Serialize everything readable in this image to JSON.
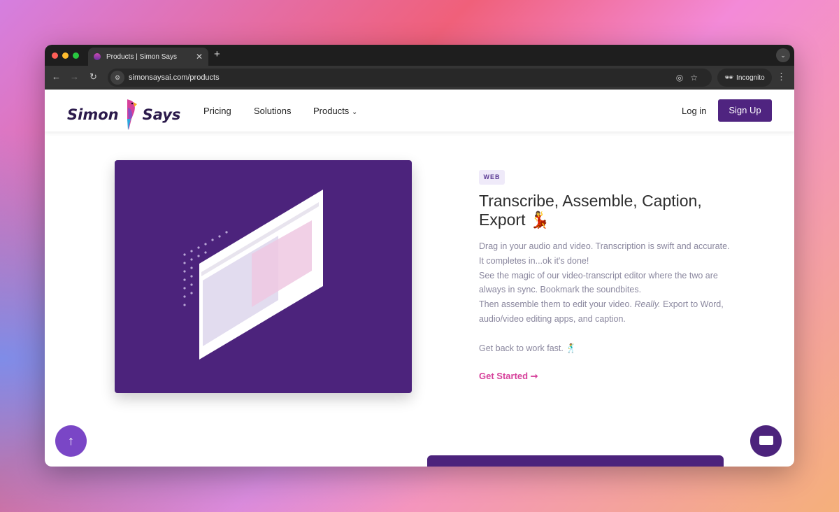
{
  "browser": {
    "tab_title": "Products | Simon Says",
    "url": "simonsaysai.com/products",
    "incognito_label": "Incognito"
  },
  "header": {
    "logo_left": "Simon",
    "logo_right": "Says",
    "nav": [
      "Pricing",
      "Solutions",
      "Products"
    ],
    "login": "Log in",
    "signup": "Sign Up"
  },
  "content": {
    "badge": "WEB",
    "title": "Transcribe, Assemble, Caption, Export 💃",
    "paragraphs": [
      "Drag in your audio and video. Transcription is swift and accurate. It completes in...ok it's done!",
      "See the magic of our video-transcript editor where the two are always in sync. Bookmark the soundbites.",
      "Then assemble them to edit your video.",
      "Really.",
      "Export to Word, audio/video editing apps, and caption.",
      "Get back to work fast. 🕺"
    ],
    "cta": "Get Started ➞"
  },
  "colors": {
    "brand": "#4c237c",
    "accent": "#d6409a"
  }
}
